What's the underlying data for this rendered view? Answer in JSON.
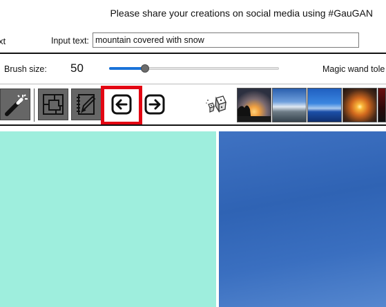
{
  "banner": {
    "text": "Please share your creations on social media using #GauGAN"
  },
  "input_row": {
    "cut_label": "xt",
    "label": "Input text:",
    "value": "mountain covered with snow"
  },
  "brush": {
    "label": "Brush size:",
    "value": "50",
    "slider_fraction": 0.21,
    "wand_label": "Magic wand tole"
  },
  "toolbar": {
    "icons": [
      "magic-wand",
      "segmentation-map",
      "sketch-notebook",
      "undo-arrow-left",
      "redo-arrow-right",
      "random-dice"
    ],
    "thumbnails": [
      "sunset-lake",
      "sky-road",
      "lake-horizon",
      "sunset-sea",
      "dark-landscape"
    ]
  },
  "canvas": {
    "segmentation_color": "#9eeedd",
    "output_sky_color": "#2f63b4"
  },
  "colors": {
    "highlight": "#e30613",
    "slider_accent": "#1a73d9"
  }
}
